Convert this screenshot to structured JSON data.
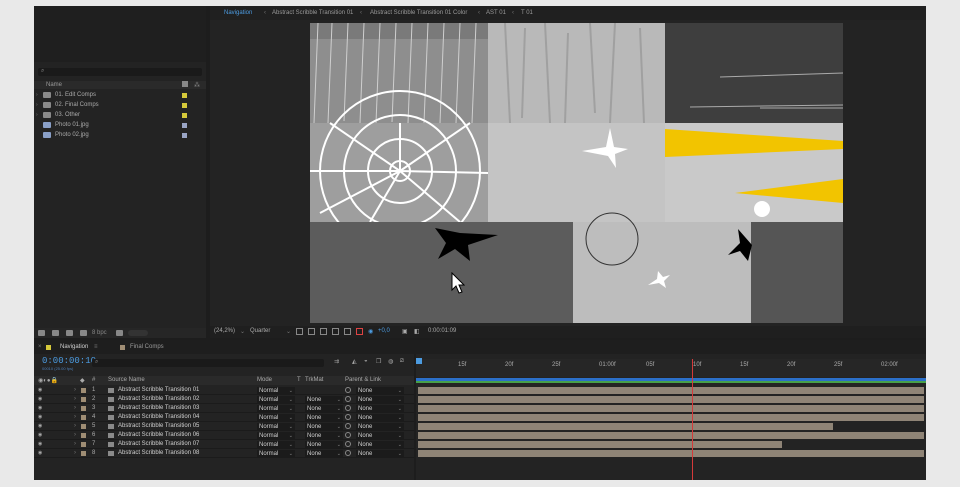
{
  "project": {
    "columns": {
      "name": "Name"
    },
    "items": [
      {
        "label": "01. Edit Comps",
        "kind": "folder",
        "tag": "#d6c93a"
      },
      {
        "label": "02. Final Comps",
        "kind": "folder",
        "tag": "#d6c93a"
      },
      {
        "label": "03. Other",
        "kind": "folder",
        "tag": "#d6c93a"
      },
      {
        "label": "Photo 01.jpg",
        "kind": "file",
        "tag": "#9aa4c4"
      },
      {
        "label": "Photo 02.jpg",
        "kind": "file",
        "tag": "#9aa4c4"
      }
    ],
    "bpc": "8 bpc"
  },
  "viewer": {
    "tabs": [
      "Navigation",
      "Abstract Scribble Transition 01",
      "Abstract Scribble Transition 01 Color",
      "AST 01",
      "T 01"
    ],
    "zoom": "(24,2%)",
    "resolution": "Quarter",
    "exposure": "+0,0",
    "timecode": "0:00:01:09"
  },
  "timeline": {
    "tabs": [
      "Navigation",
      "Final Comps"
    ],
    "timecode": "0:00:00:10",
    "timecode_sub": "00010 (25.00 fps)",
    "columns": {
      "source": "Source Name",
      "mode": "Mode",
      "t": "T",
      "trkmat": "TrkMat",
      "parent": "Parent & Link"
    },
    "layers": [
      {
        "num": "1",
        "name": "Abstract Scribble Transition 01",
        "mode": "Normal",
        "trkmat": "",
        "parent": "None",
        "end": 1.0
      },
      {
        "num": "2",
        "name": "Abstract Scribble Transition 02",
        "mode": "Normal",
        "trkmat": "None",
        "parent": "None",
        "end": 1.0
      },
      {
        "num": "3",
        "name": "Abstract Scribble Transition 03",
        "mode": "Normal",
        "trkmat": "None",
        "parent": "None",
        "end": 1.0
      },
      {
        "num": "4",
        "name": "Abstract Scribble Transition 04",
        "mode": "Normal",
        "trkmat": "None",
        "parent": "None",
        "end": 1.0
      },
      {
        "num": "5",
        "name": "Abstract Scribble Transition 05",
        "mode": "Normal",
        "trkmat": "None",
        "parent": "None",
        "end": 0.82
      },
      {
        "num": "6",
        "name": "Abstract Scribble Transition 06",
        "mode": "Normal",
        "trkmat": "None",
        "parent": "None",
        "end": 1.0
      },
      {
        "num": "7",
        "name": "Abstract Scribble Transition 07",
        "mode": "Normal",
        "trkmat": "None",
        "parent": "None",
        "end": 0.72
      },
      {
        "num": "8",
        "name": "Abstract Scribble Transition 08",
        "mode": "Normal",
        "trkmat": "None",
        "parent": "None",
        "end": 1.0
      }
    ],
    "ruler": [
      "15f",
      "20f",
      "25f",
      "01:00f",
      "05f",
      "10f",
      "15f",
      "20f",
      "25f",
      "02:00f"
    ]
  },
  "colors": {
    "accent": "#4c9be0",
    "yellow": "#f2c400",
    "playhead": "#d43a3a"
  }
}
